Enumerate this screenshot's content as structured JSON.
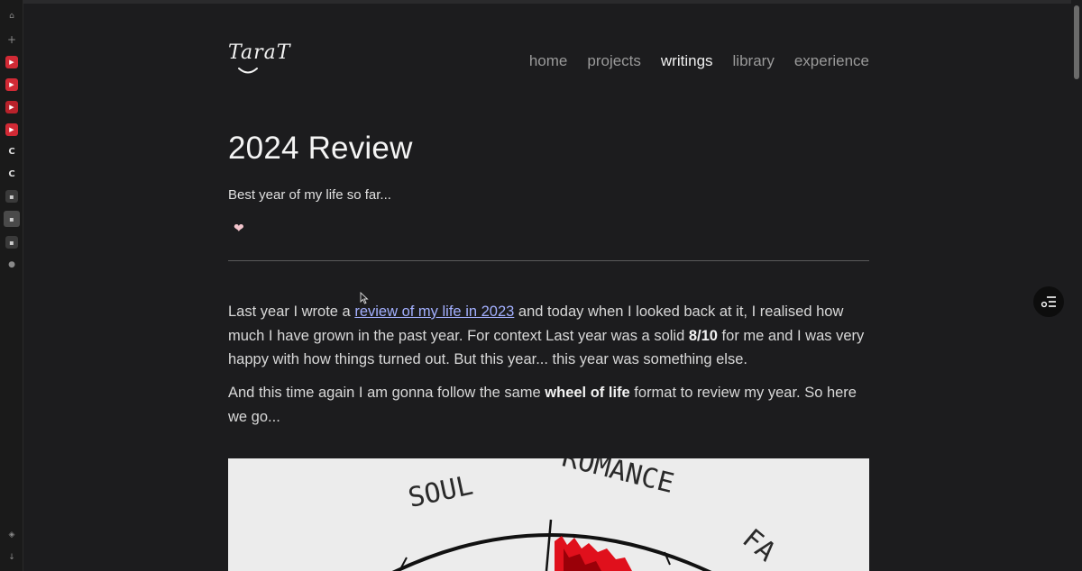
{
  "nav": {
    "logo": "TaraT",
    "items": [
      {
        "label": "home",
        "active": false
      },
      {
        "label": "projects",
        "active": false
      },
      {
        "label": "writings",
        "active": true
      },
      {
        "label": "library",
        "active": false
      },
      {
        "label": "experience",
        "active": false
      }
    ]
  },
  "article": {
    "title": "2024 Review",
    "subtitle": "Best year of my life so far...",
    "reaction_icon": "heart-icon",
    "p1": {
      "before_link": "Last year I wrote a ",
      "link": "review of my life in 2023",
      "after_link": " and today when I looked back at it, I realised how much I have grown in the past year. For context Last year was a solid ",
      "bold": "8/10",
      "end": " for me and I was very happy with how things turned out. But this year... this year was something else."
    },
    "p2": {
      "before_bold": "And this time again I am gonna follow the same ",
      "bold": "wheel of life",
      "end": " format to review my year. So here we go..."
    },
    "wheel_labels": [
      "SOUL",
      "ROMANCE",
      "FA"
    ]
  },
  "colors": {
    "background": "#1c1c1e",
    "link": "#a3b0ff",
    "accent_red": "#e0101c"
  }
}
